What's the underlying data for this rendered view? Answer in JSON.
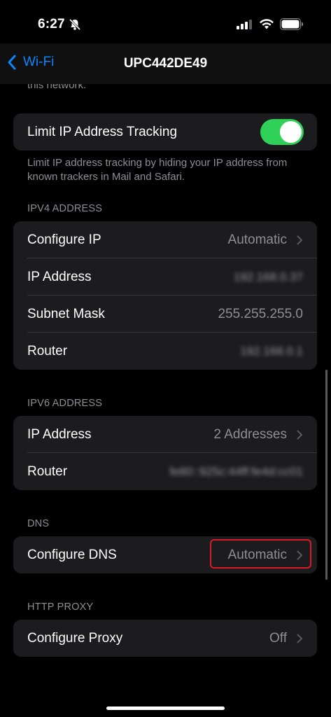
{
  "status_bar": {
    "time": "6:27",
    "icons": [
      "mute-icon",
      "cellular-signal-icon",
      "wifi-icon",
      "battery-icon"
    ]
  },
  "nav": {
    "back_label": "Wi-Fi",
    "title": "UPC442DE49"
  },
  "top_cut_text": "this network.",
  "limit_tracking": {
    "label": "Limit IP Address Tracking",
    "enabled": true,
    "footer": "Limit IP address tracking by hiding your IP address from known trackers in Mail and Safari."
  },
  "ipv4": {
    "header": "IPV4 ADDRESS",
    "configure_label": "Configure IP",
    "configure_value": "Automatic",
    "ip_label": "IP Address",
    "ip_value": "192.168.0.37",
    "subnet_label": "Subnet Mask",
    "subnet_value": "255.255.255.0",
    "router_label": "Router",
    "router_value": "192.168.0.1"
  },
  "ipv6": {
    "header": "IPV6 ADDRESS",
    "ip_label": "IP Address",
    "ip_value": "2 Addresses",
    "router_label": "Router",
    "router_value": "fe80::925c:44ff:fe4d:cc01"
  },
  "dns": {
    "header": "DNS",
    "configure_label": "Configure DNS",
    "configure_value": "Automatic"
  },
  "proxy": {
    "header": "HTTP PROXY",
    "configure_label": "Configure Proxy",
    "configure_value": "Off"
  },
  "colors": {
    "accent": "#0a84ff",
    "toggle_on": "#30d158",
    "highlight": "#d9182a"
  }
}
